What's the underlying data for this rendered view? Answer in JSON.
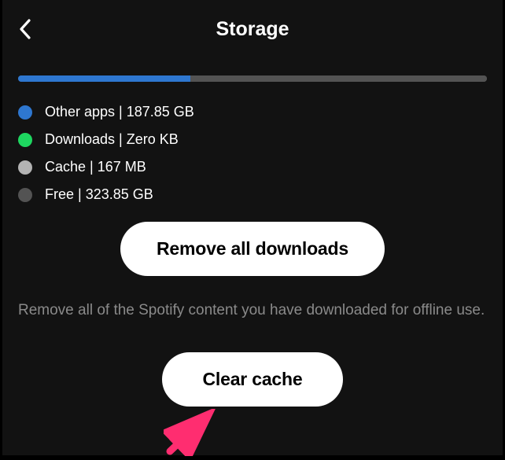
{
  "header": {
    "title": "Storage"
  },
  "storage_bar": {
    "other_pct": 36.7,
    "downloads_pct": 0,
    "cache_pct": 0.05,
    "free_pct": 63.25
  },
  "legend": {
    "other": "Other apps | 187.85 GB",
    "downloads": "Downloads | Zero KB",
    "cache": "Cache | 167 MB",
    "free": "Free | 323.85 GB"
  },
  "buttons": {
    "remove_downloads": "Remove all downloads",
    "clear_cache": "Clear cache"
  },
  "descriptions": {
    "remove_downloads": "Remove all of the Spotify content you have downloaded for offline use."
  },
  "colors": {
    "other": "#2e77d0",
    "downloads": "#1ed760",
    "cache": "#b3b3b3",
    "free": "#535353",
    "annotation_arrow": "#ff2d70"
  }
}
